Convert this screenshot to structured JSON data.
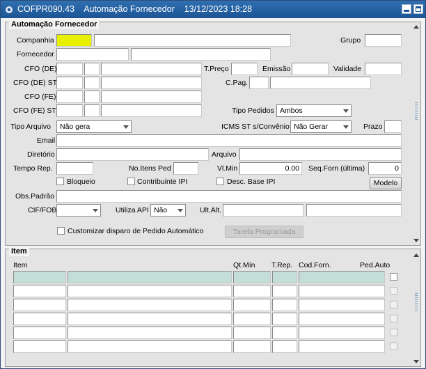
{
  "window": {
    "form_code": "COFPR090.43",
    "title": "Automação Fornecedor",
    "date_time": "13/12/2023 18:28"
  },
  "header_block": {
    "title": "Automação Fornecedor",
    "labels": {
      "companhia": "Companhia",
      "grupo": "Grupo",
      "fornecedor": "Fornecedor",
      "cfo_de": "CFO (DE)",
      "t_preco": "T.Preço",
      "emissao": "Emissão",
      "validade": "Validade",
      "cfo_de_st": "CFO (DE) ST",
      "c_pag": "C.Pag.",
      "cfo_fe": "CFO (FE)",
      "cfo_fe_st": "CFO (FE) ST",
      "tipo_pedidos": "Tipo Pedidos",
      "tipo_arquivo": "Tipo Arquivo",
      "icms_st": "ICMS ST s/Convênio",
      "prazo": "Prazo",
      "email": "Email",
      "diretorio": "Diretório",
      "arquivo": "Arquivo",
      "tempo_rep": "Tempo Rep.",
      "no_itens_ped": "No.Itens Ped",
      "vl_min": "Vl.Min",
      "seq_forn": "Seq.Forn (última)",
      "bloqueio": "Bloqueio",
      "contribuinte_ipi": "Contribuinte IPI",
      "desc_base_ipi": "Desc. Base IPI",
      "obs_padrao": "Obs.Padrão",
      "cif_fob": "CIF/FOB",
      "utiliza_api": "Utiliza API",
      "ult_alt": "Ult.Alt.",
      "customizar": "Customizar disparo de Pedido Automático"
    },
    "values": {
      "tipo_pedidos": "Ambos",
      "tipo_arquivo": "Não gera",
      "icms_st": "Não Gerar",
      "utiliza_api": "Não",
      "vl_min": "0.00",
      "seq_forn": "0"
    },
    "buttons": {
      "modelo": "Modelo",
      "tarefa_programada": "Tarefa Programada"
    }
  },
  "item_block": {
    "title": "Item",
    "columns": [
      "Item",
      "Qt.Mín",
      "T.Rep.",
      "Cod.Forn.",
      "Ped.Auto"
    ],
    "row_count": 6
  }
}
